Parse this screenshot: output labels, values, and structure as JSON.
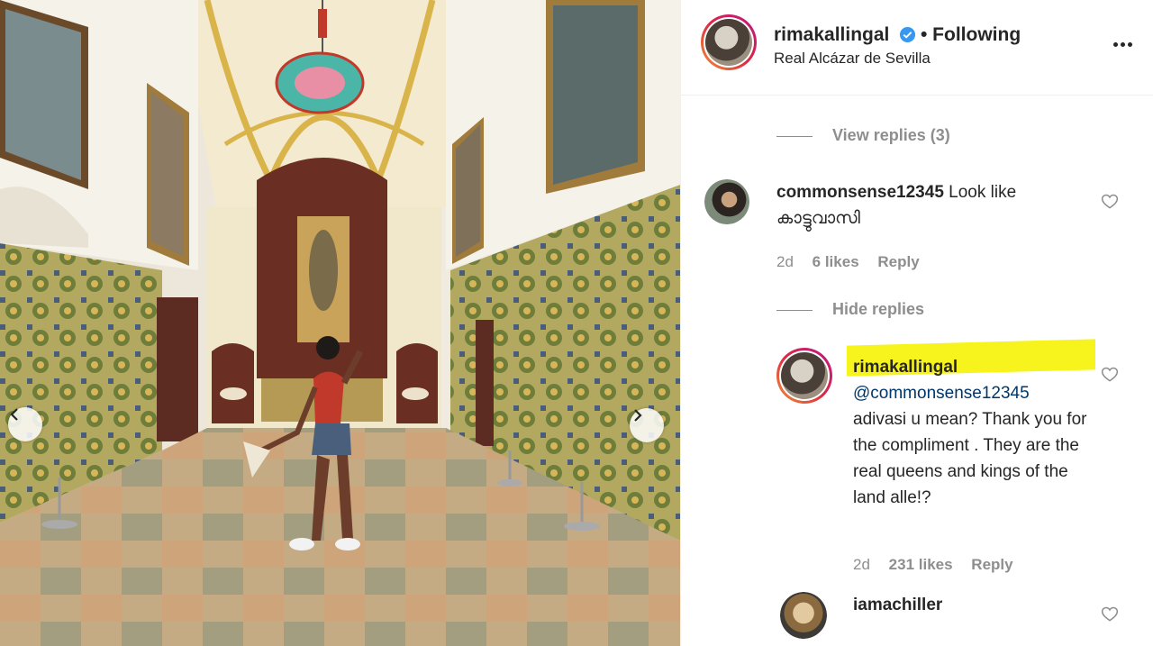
{
  "post": {
    "username": "rimakallingal",
    "follow_status": "• Following",
    "location": "Real Alcázar de Sevilla"
  },
  "thread": {
    "view_replies": "View replies (3)",
    "hide_replies": "Hide replies"
  },
  "comments": [
    {
      "username": "commonsense12345",
      "text": "Look like കാട്ടുവാസി",
      "age": "2d",
      "likes": "6 likes",
      "reply_label": "Reply"
    },
    {
      "username": "rimakallingal",
      "mention": "@commonsense12345",
      "text": "adivasi u mean? Thank you for the compliment . They are the real queens and kings of the land alle!?",
      "age": "2d",
      "likes": "231 likes",
      "reply_label": "Reply",
      "highlighted": true
    },
    {
      "username": "iamachiller"
    }
  ],
  "colors": {
    "text": "#262626",
    "muted": "#8e8e8e",
    "verified": "#3897f0",
    "highlight": "#f7f31c",
    "mention": "#00376b"
  },
  "icons": [
    "verified-badge-icon",
    "more-options-icon",
    "heart-icon",
    "chevron-left-icon",
    "chevron-right-icon"
  ]
}
